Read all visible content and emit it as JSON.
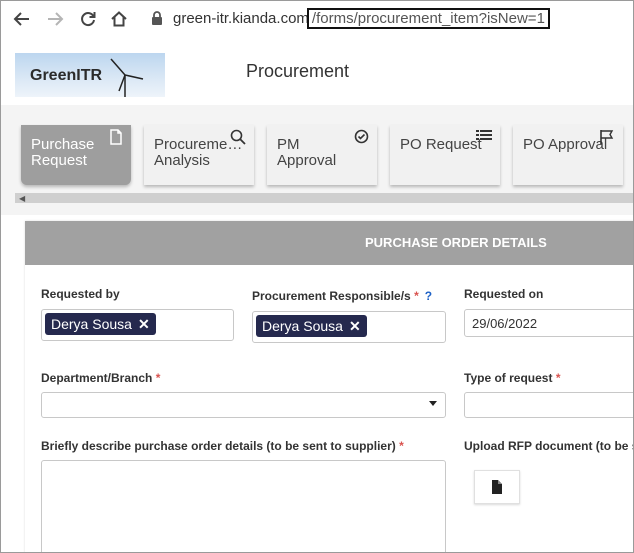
{
  "browser": {
    "url_host": "green-itr.kianda.com",
    "url_path": "/forms/procurement_item?isNew=1",
    "icons": [
      "back-arrow-icon",
      "forward-arrow-icon",
      "reload-icon",
      "home-icon",
      "lock-icon"
    ]
  },
  "header": {
    "logo_text": "GreenITR",
    "app_title": "Procurement"
  },
  "tabs": [
    {
      "label_line1": "Purchase",
      "label_line2": "Request",
      "icon": "document-icon",
      "active": true
    },
    {
      "label_line1": "Procureme…",
      "label_line2": "Analysis",
      "icon": "search-icon",
      "active": false
    },
    {
      "label_line1": "PM",
      "label_line2": "Approval",
      "icon": "check-circle-icon",
      "active": false
    },
    {
      "label_line1": "PO Request",
      "label_line2": "",
      "icon": "list-icon",
      "active": false
    },
    {
      "label_line1": "PO Approval",
      "label_line2": "",
      "icon": "flag-icon",
      "active": false
    }
  ],
  "form": {
    "section_title": "PURCHASE ORDER DETAILS",
    "requested_by": {
      "label": "Requested by",
      "value": "Derya Sousa"
    },
    "procurement_responsible": {
      "label": "Procurement Responsible/s",
      "required_mark": "*",
      "help": "?",
      "value": "Derya Sousa"
    },
    "requested_on": {
      "label": "Requested on",
      "value": "29/06/2022"
    },
    "department": {
      "label": "Department/Branch",
      "required_mark": "*",
      "value": ""
    },
    "type_of_request": {
      "label": "Type of request",
      "required_mark": "*",
      "value": ""
    },
    "description": {
      "label": "Briefly describe purchase order details (to be sent to supplier)",
      "required_mark": "*",
      "value": ""
    },
    "upload_rfp": {
      "label": "Upload RFP document (to be se"
    }
  },
  "colors": {
    "chip_bg": "#25294e",
    "panel_header": "#a1a1a1",
    "active_tab": "#9e9e9e",
    "required": "#d9534f",
    "help": "#1f62c7"
  }
}
